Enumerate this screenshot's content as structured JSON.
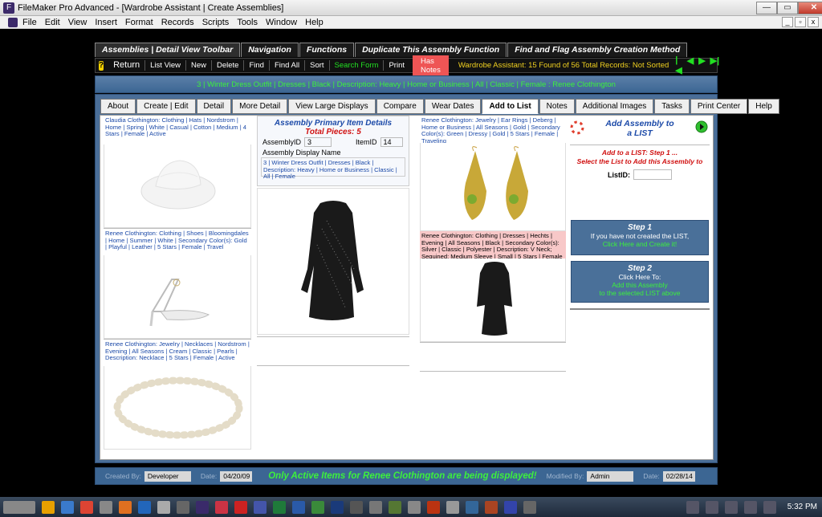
{
  "window": {
    "title": "FileMaker Pro Advanced - [Wardrobe Assistant | Create Assemblies]"
  },
  "menu": [
    "File",
    "Edit",
    "View",
    "Insert",
    "Format",
    "Records",
    "Scripts",
    "Tools",
    "Window",
    "Help"
  ],
  "toptabs": [
    "Assemblies | Detail View Toolbar",
    "Navigation",
    "Functions",
    "Duplicate This Assembly Function",
    "Find and Flag Assembly Creation Method"
  ],
  "toolbar": {
    "help": "?",
    "return": "Return",
    "list_view": "List View",
    "new": "New",
    "delete": "Delete",
    "find": "Find",
    "find_all": "Find All",
    "sort": "Sort",
    "search_form": "Search Form",
    "print": "Print",
    "has_notes": "Has Notes",
    "status": "Wardrobe Assistant: 15 Found of 56 Total Records: Not Sorted"
  },
  "infobar": "3 | Winter Dress Outfit | Dresses | Black | Description: Heavy | Home or Business | All | Classic | Female : Renee Clothington",
  "tabs": [
    "About",
    "Create | Edit",
    "Detail",
    "More Detail",
    "View Large Displays",
    "Compare",
    "Wear Dates",
    "Add to List",
    "Notes",
    "Additional Images",
    "Tasks",
    "Print Center",
    "Help"
  ],
  "items": {
    "hat": "Claudia Clothington: Clothing | Hats | Nordstrom | Home | Spring | White | Casual | Cotton | Medium | 4 Stars | Female | Active",
    "shoe": "Renee Clothington: Clothing | Shoes | Bloomingdales | Home | Summer | White | Secondary Color(s): Gold | Playful | Leather | 5 Stars | Female | Travel",
    "necklace": "Renee Clothington: Jewelry | Necklaces | Nordstrom | Evening | All Seasons | Cream | Classic | Pearls | Description: Necklace | 5 Stars | Female | Active",
    "earrings": "Renee Clothington: Jewelry | Ear Rings | Deberg | Home or Business | All Seasons | Gold | Secondary Color(s): Green | Dressy | Gold | 5 Stars | Female | Traveling",
    "dress": "Renee Clothington: Clothing | Dresses | Hechts | Evening | All Seasons | Black | Secondary Color(s): Silver | Classic | Polyester | Description: V Neck; Sequined; Medium Sleeve | Small | 5 Stars | Female"
  },
  "details": {
    "heading": "Assembly Primary Item Details",
    "total": "Total Pieces: 5",
    "assembly_id_label": "AssemblyID",
    "assembly_id": "3",
    "item_id_label": "ItemID",
    "item_id": "14",
    "display_name_label": "Assembly Display Name",
    "display_name": "3 | Winter Dress Outfit | Dresses | Black | Description: Heavy | Home or Business | Classic | All | Female"
  },
  "addlist": {
    "heading1": "Add Assembly to",
    "heading2": "a LIST",
    "step_text1": "Add to a LIST: Step 1 ...",
    "step_text2": "Select the List to Add this Assembly to",
    "listid_label": "ListID:",
    "step1_title": "Step 1",
    "step1_line": "If you have not created the LIST,",
    "step1_link": "Click Here and Create it!",
    "step2_title": "Step 2",
    "step2_line": "Click Here To:",
    "step2_link1": "Add this Assembly",
    "step2_link2": "to the selected LIST above"
  },
  "footer": {
    "created_by_label": "Created By:",
    "created_by": "Developer",
    "date_label": "Date:",
    "created_date": "04/20/09",
    "message": "Only Active Items for Renee Clothington are being displayed!",
    "modified_by_label": "Modified By:",
    "modified_by": "Admin",
    "modified_date_label": "Date:",
    "modified_date": "02/28/14"
  },
  "taskbar": {
    "time": "5:32 PM"
  },
  "colors": {
    "accent_green": "#3cf03c",
    "panel_blue": "#4a6e98",
    "status_yellow": "#f0d020",
    "alert_red": "#d01010"
  }
}
